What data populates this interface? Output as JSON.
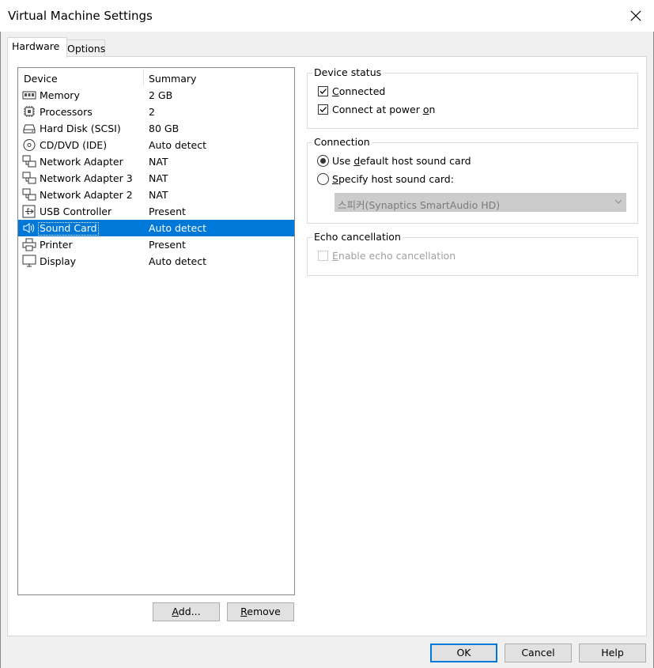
{
  "window": {
    "title": "Virtual Machine Settings"
  },
  "tabs": [
    {
      "label": "Hardware"
    },
    {
      "label": "Options"
    }
  ],
  "device_list": {
    "headers": {
      "device": "Device",
      "summary": "Summary"
    },
    "rows": [
      {
        "device": "Memory",
        "summary": "2 GB",
        "icon": "memory-icon"
      },
      {
        "device": "Processors",
        "summary": "2",
        "icon": "processor-icon"
      },
      {
        "device": "Hard Disk (SCSI)",
        "summary": "80 GB",
        "icon": "hard-disk-icon"
      },
      {
        "device": "CD/DVD (IDE)",
        "summary": "Auto detect",
        "icon": "cd-dvd-icon"
      },
      {
        "device": "Network Adapter",
        "summary": "NAT",
        "icon": "network-adapter-icon"
      },
      {
        "device": "Network Adapter 3",
        "summary": "NAT",
        "icon": "network-adapter-icon"
      },
      {
        "device": "Network Adapter 2",
        "summary": "NAT",
        "icon": "network-adapter-icon"
      },
      {
        "device": "USB Controller",
        "summary": "Present",
        "icon": "usb-icon"
      },
      {
        "device": "Sound Card",
        "summary": "Auto detect",
        "icon": "speaker-icon",
        "selected": true
      },
      {
        "device": "Printer",
        "summary": "Present",
        "icon": "printer-icon"
      },
      {
        "device": "Display",
        "summary": "Auto detect",
        "icon": "monitor-icon"
      }
    ],
    "add_pre": "",
    "add_ul": "A",
    "add_post": "dd...",
    "remove_pre": "",
    "remove_ul": "R",
    "remove_post": "emove"
  },
  "device_status": {
    "legend": "Device status",
    "connected": {
      "pre": "",
      "ul": "C",
      "post": "onnected",
      "checked": true
    },
    "power_on": {
      "pre": "Connect at power ",
      "ul": "o",
      "post": "n",
      "checked": true
    }
  },
  "connection": {
    "legend": "Connection",
    "use_default": {
      "pre": "Use ",
      "ul": "d",
      "post": "efault host sound card",
      "selected": true
    },
    "specify": {
      "pre": "",
      "ul": "S",
      "post": "pecify host sound card:",
      "selected": false
    },
    "sound_card_value": "스피커(Synaptics SmartAudio HD)"
  },
  "echo": {
    "legend": "Echo cancellation",
    "enable": {
      "pre": "",
      "ul": "E",
      "post": "nable echo cancellation",
      "checked": false,
      "disabled": true
    }
  },
  "footer": {
    "ok": "OK",
    "cancel": "Cancel",
    "help": "Help"
  },
  "colors": {
    "selection": "#0078d7",
    "default_button_border": "#0078d7"
  }
}
